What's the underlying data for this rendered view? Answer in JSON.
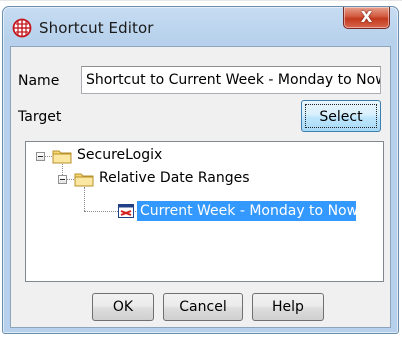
{
  "window": {
    "title": "Shortcut Editor",
    "app_icon": "globe-grid-icon",
    "close_label": "X"
  },
  "form": {
    "name_label": "Name",
    "name_value": "Shortcut to Current Week - Monday to Now",
    "target_label": "Target",
    "select_label": "Select"
  },
  "tree": {
    "root": {
      "label": "SecureLogix",
      "icon": "folder-icon",
      "expanded": true
    },
    "child": {
      "label": "Relative Date Ranges",
      "icon": "folder-icon",
      "expanded": true
    },
    "leaf": {
      "label": "Current Week - Monday to Now",
      "icon": "calendar-range-icon",
      "selected": true
    }
  },
  "buttons": {
    "ok": "OK",
    "cancel": "Cancel",
    "help": "Help"
  },
  "colors": {
    "selection": "#3399ff",
    "titlebar": "#b9d1ea",
    "close": "#c7432a"
  }
}
